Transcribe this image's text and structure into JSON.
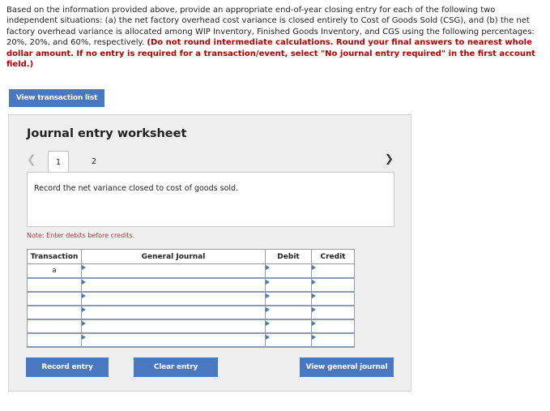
{
  "instructions": {
    "normal": "Based on the information provided above, provide an appropriate end-of-year closing entry for each of the following two independent situations: (a) the net factory overhead cost variance is closed entirely to Cost of Goods Sold (CSG), and (b) the net factory overhead variance is allocated among WIP Inventory, Finished Goods Inventory, and CGS using the following percentages: 20%, 20%, and 60%, respectively. ",
    "red": "(Do not round intermediate calculations. Round your final answers to nearest whole dollar amount. If no entry is required for a transaction/event, select \"No journal entry required\" in the first account field.)"
  },
  "view_transaction_button": "View transaction list",
  "worksheet": {
    "title": "Journal entry worksheet",
    "tabs": [
      "1",
      "2"
    ],
    "description": "Record the net variance closed to cost of goods sold.",
    "note": "Note: Enter debits before credits.",
    "columns": [
      "Transaction",
      "General Journal",
      "Debit",
      "Credit"
    ],
    "rows": [
      {
        "transaction": "a"
      },
      {
        "transaction": ""
      },
      {
        "transaction": ""
      },
      {
        "transaction": ""
      },
      {
        "transaction": ""
      },
      {
        "transaction": ""
      }
    ]
  },
  "buttons": {
    "record": "Record entry",
    "clear": "Clear entry",
    "view_general": "View general journal"
  },
  "colors": {
    "button_blue": "#4a78c0",
    "instruction_red": "#b30000"
  }
}
